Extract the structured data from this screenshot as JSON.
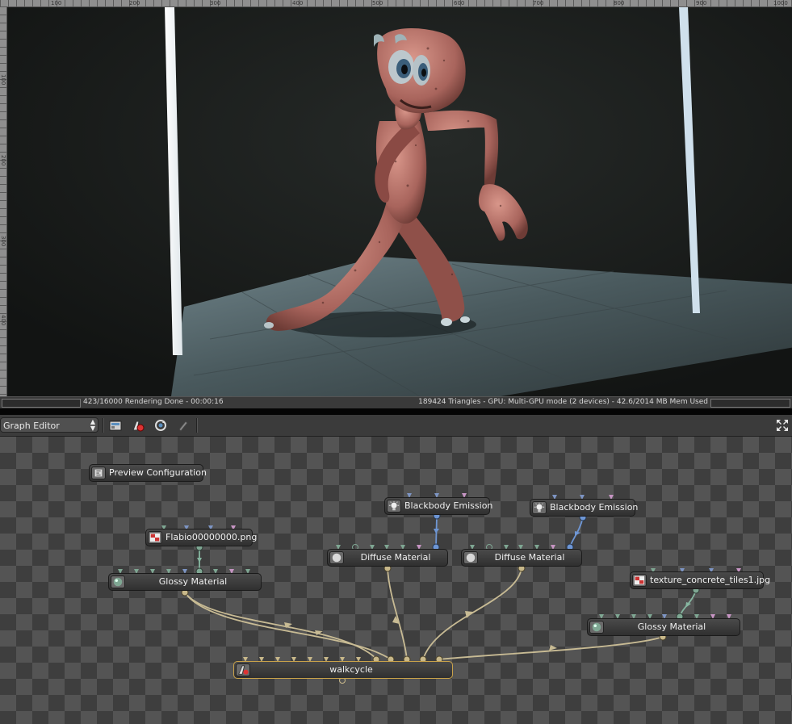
{
  "viewport": {
    "ruler_top_ticks": [
      "100",
      "200",
      "300",
      "400",
      "500",
      "600",
      "700",
      "800",
      "900",
      "1000"
    ],
    "ruler_left_ticks": [
      "100",
      "200",
      "300",
      "400"
    ]
  },
  "status": {
    "left": "423/16000 Rendering Done - 00:00:16",
    "right": "189424 Triangles - GPU: Multi-GPU mode (2 devices) - 42.6/2014 MB Mem Used"
  },
  "toolbar": {
    "editor": "Graph Editor",
    "icons": [
      "render-settings-icon",
      "material-picker-icon",
      "refresh-icon",
      "paint-icon"
    ],
    "maximize_icon": "maximize-icon"
  },
  "nodes": {
    "preview_config": "Preview Configuration",
    "flabio_png": "Flabio00000000.png",
    "glossy_left": "Glossy Material",
    "blackbody_1": "Blackbody Emission",
    "diffuse_1": "Diffuse Material",
    "blackbody_2": "Blackbody Emission",
    "diffuse_2": "Diffuse Material",
    "texture_concrete": "texture_concrete_tiles1.jpg",
    "glossy_right": "Glossy Material",
    "walkcycle": "walkcycle"
  },
  "colors": {
    "pin_green": "#7fa793",
    "pin_blue": "#7d95c4",
    "pin_pink": "#c795c4",
    "pin_tan": "#c8b88a",
    "wire_tan": "#c8bb94",
    "wire_green": "#86b6a0",
    "wire_blue": "#6e96d4"
  }
}
